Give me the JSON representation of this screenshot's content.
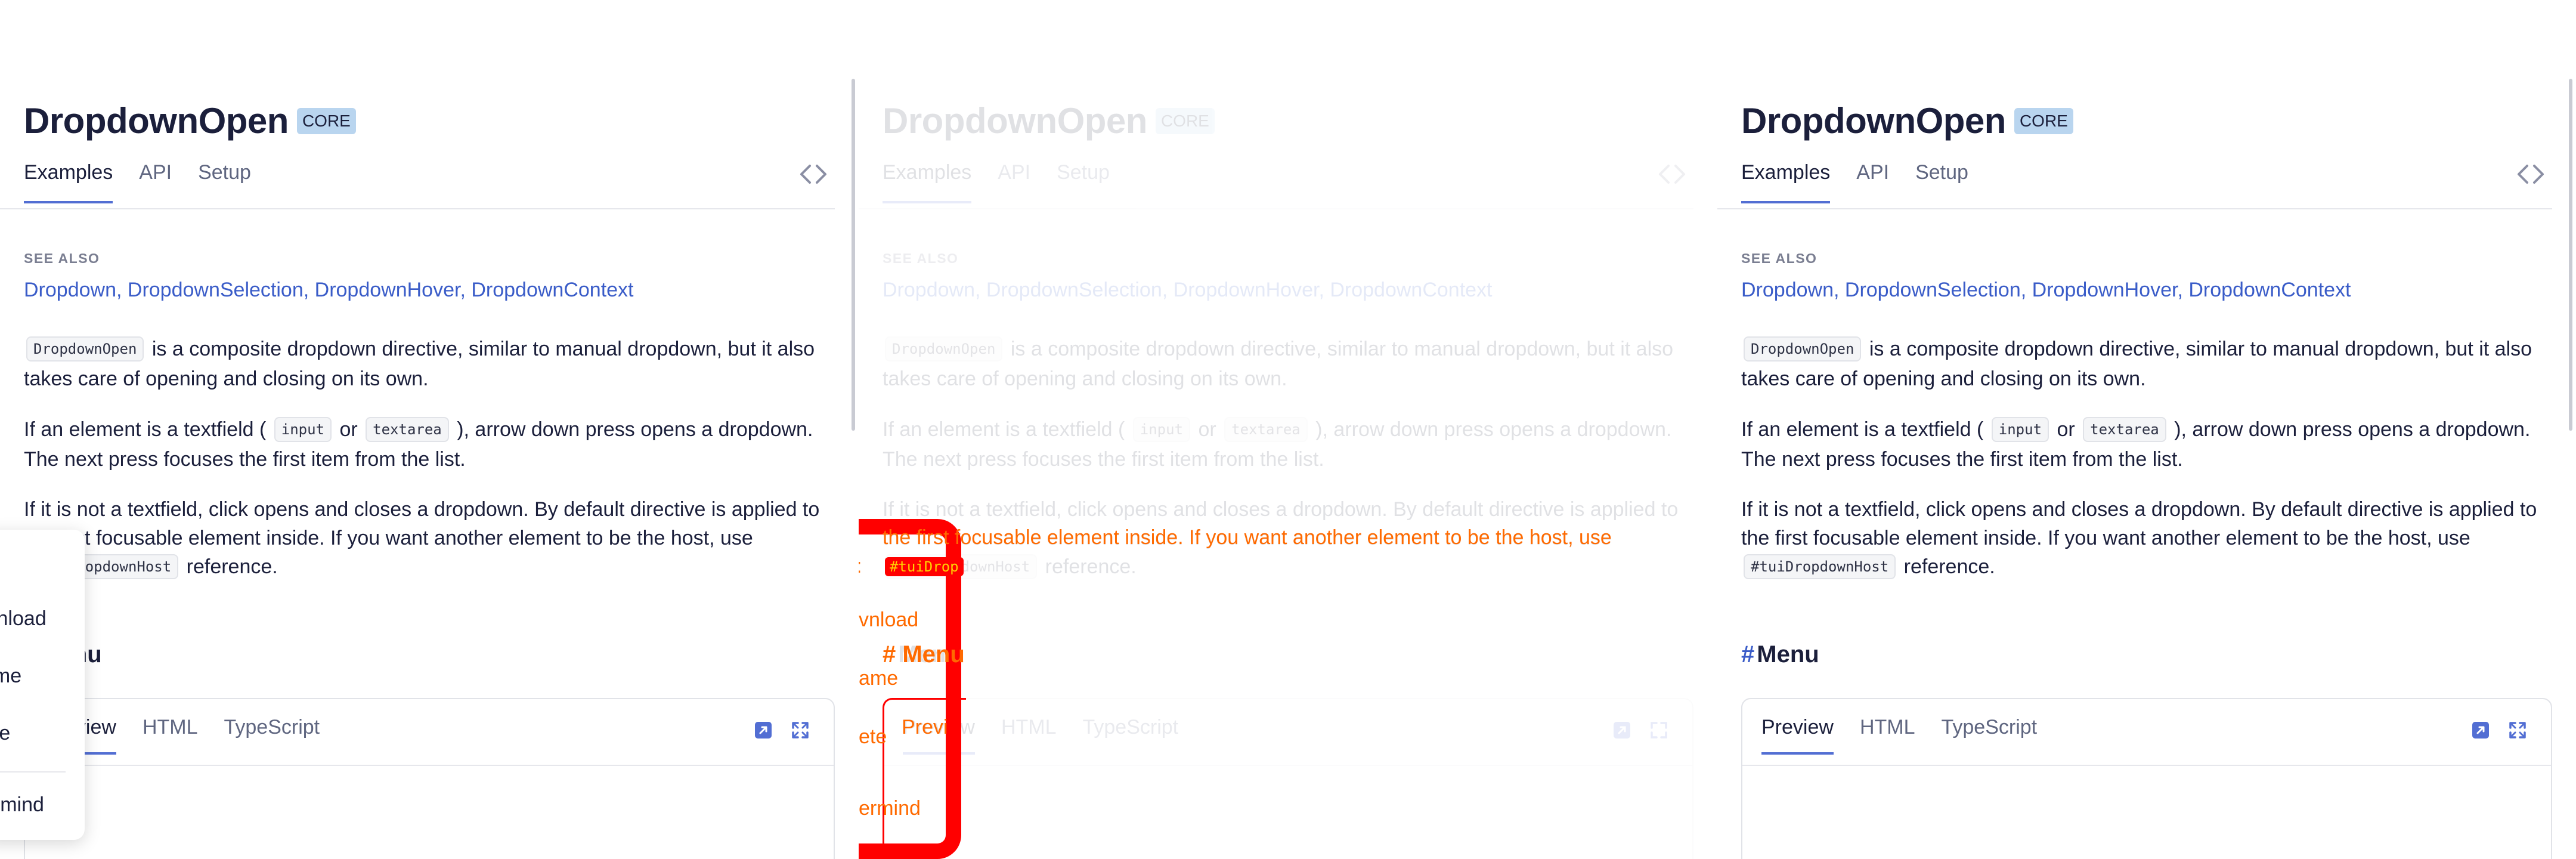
{
  "page": {
    "title": "DropdownOpen",
    "badge": "CORE",
    "tabs": [
      "Examples",
      "API",
      "Setup"
    ],
    "see_also": {
      "label": "SEE ALSO",
      "links": [
        "Dropdown",
        "DropdownSelection",
        "DropdownHover",
        "DropdownContext"
      ],
      "separator": ","
    },
    "para_a": {
      "code": "DropdownOpen",
      "text": "is a composite dropdown directive, similar to manual dropdown, but it also takes care of opening and closing on its own."
    },
    "para_b": {
      "pre": "If an element is a textfield (",
      "code1": "input",
      "mid": "or",
      "code2": "textarea",
      "post": "), arrow down press opens a dropdown. The next press focuses the first item from the list."
    },
    "para_c": {
      "text": "If it is not a textfield, click opens and closes a dropdown. By default directive is applied to the first focusable element inside. If you want another element to be the host, use",
      "code": "#tuiDropdownHost",
      "post": "reference."
    },
    "section": {
      "hash": "#",
      "title": "Menu"
    },
    "example": {
      "tabs": [
        "Preview",
        "HTML",
        "TypeScript"
      ],
      "icons": [
        "open-in-editor-icon",
        "fullscreen-icon"
      ]
    }
  },
  "panel1_overlay": {
    "partial": {
      "para_c_line2": "t focusable element inside. If you want another element to be the host, use",
      "code_tail": "opdownHost",
      "section_tail": "nu",
      "tab_tail": "iew"
    },
    "dropdown_items": [
      "t",
      "wnload",
      "ame",
      "ete",
      "ermind"
    ]
  },
  "panel2_overlay": {
    "left_labels": [
      ":",
      "vnload",
      "ame",
      "ete",
      "ermind"
    ],
    "para_c_line2": "the first focusable element inside. If you want another element to be the host, use",
    "code_fragment": "#tuiDrop",
    "section": "# Menu",
    "tab": "Previ"
  },
  "colors": {
    "accent": "#526ed3",
    "link": "#3a5cc8",
    "badge_bg": "#b9d5ef",
    "highlight": "#ff0000",
    "highlight_text": "#ff6a00"
  }
}
